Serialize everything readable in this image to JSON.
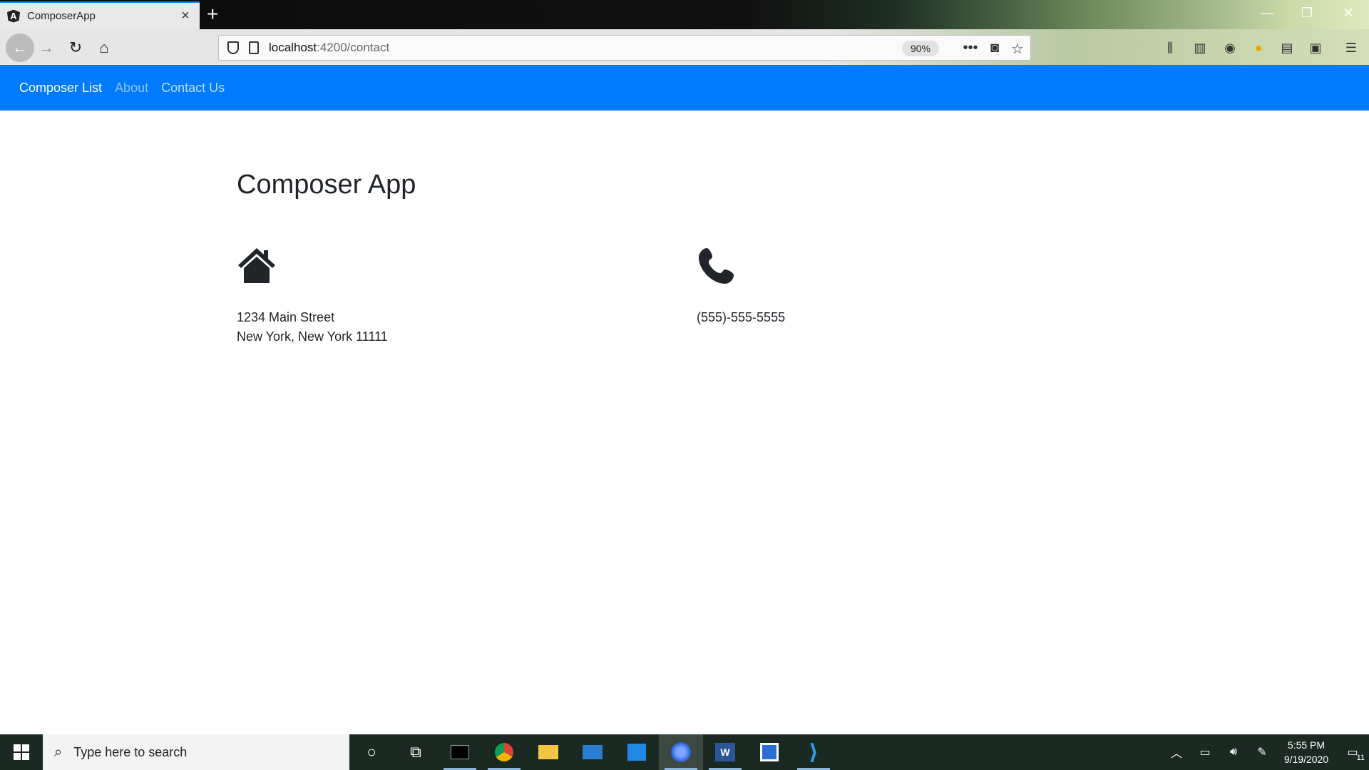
{
  "browser": {
    "tab_title": "ComposerApp",
    "tab_favicon_letter": "A",
    "url_host": "localhost",
    "url_path": ":4200/contact",
    "zoom": "90%"
  },
  "app_nav": {
    "brand": "Composer List",
    "links": [
      "About",
      "Contact Us"
    ]
  },
  "page": {
    "title": "Composer App",
    "address": {
      "line1": "1234 Main Street",
      "line2": "New York, New York 11111"
    },
    "phone": "(555)-555-5555"
  },
  "taskbar": {
    "search_placeholder": "Type here to search",
    "time": "5:55 PM",
    "date": "9/19/2020",
    "notification_count": "11"
  },
  "colors": {
    "app_navbar": "#007bff",
    "browser_accent": "#0a84ff"
  },
  "icons": [
    "home-icon",
    "phone-icon",
    "back-icon",
    "forward-icon",
    "reload-icon",
    "star-icon",
    "pocket-icon",
    "windows-start-icon",
    "search-icon"
  ]
}
